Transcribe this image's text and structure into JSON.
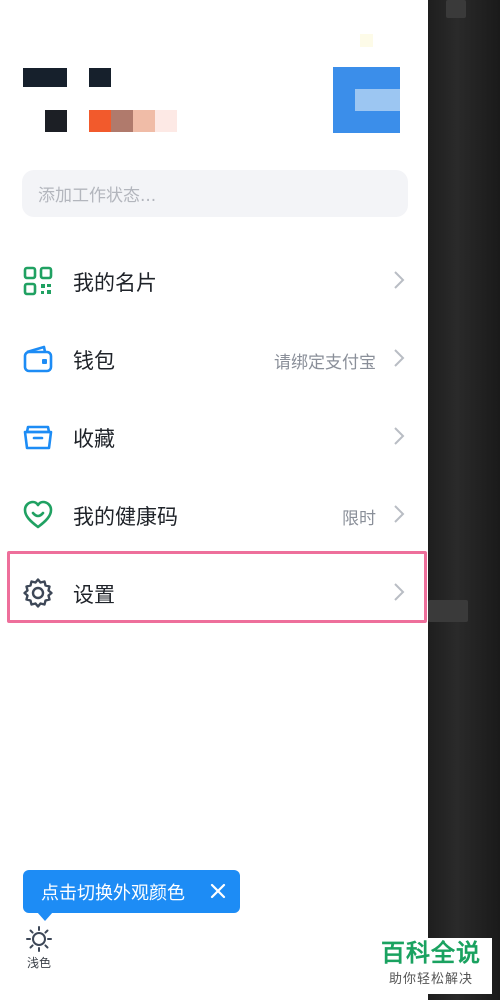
{
  "profile": {
    "status_placeholder": "添加工作状态..."
  },
  "menu": {
    "items": [
      {
        "label": "我的名片",
        "extra": "",
        "icon": "qr-code-icon"
      },
      {
        "label": "钱包",
        "extra": "请绑定支付宝",
        "icon": "wallet-icon"
      },
      {
        "label": "收藏",
        "extra": "",
        "icon": "folder-icon"
      },
      {
        "label": "我的健康码",
        "extra": "限时",
        "icon": "heart-icon"
      },
      {
        "label": "设置",
        "extra": "",
        "icon": "gear-icon"
      }
    ]
  },
  "tooltip": {
    "text": "点击切换外观颜色"
  },
  "theme": {
    "label": "浅色",
    "icon": "sun-icon"
  },
  "watermark": {
    "title": "百科全说",
    "subtitle": "助你轻松解决"
  },
  "colors": {
    "accent": "#1d8cf5",
    "qr_green": "#20a162",
    "health_green": "#20a162",
    "wallet_blue": "#1d8cf5",
    "highlight_pink": "#ee6f9b"
  }
}
